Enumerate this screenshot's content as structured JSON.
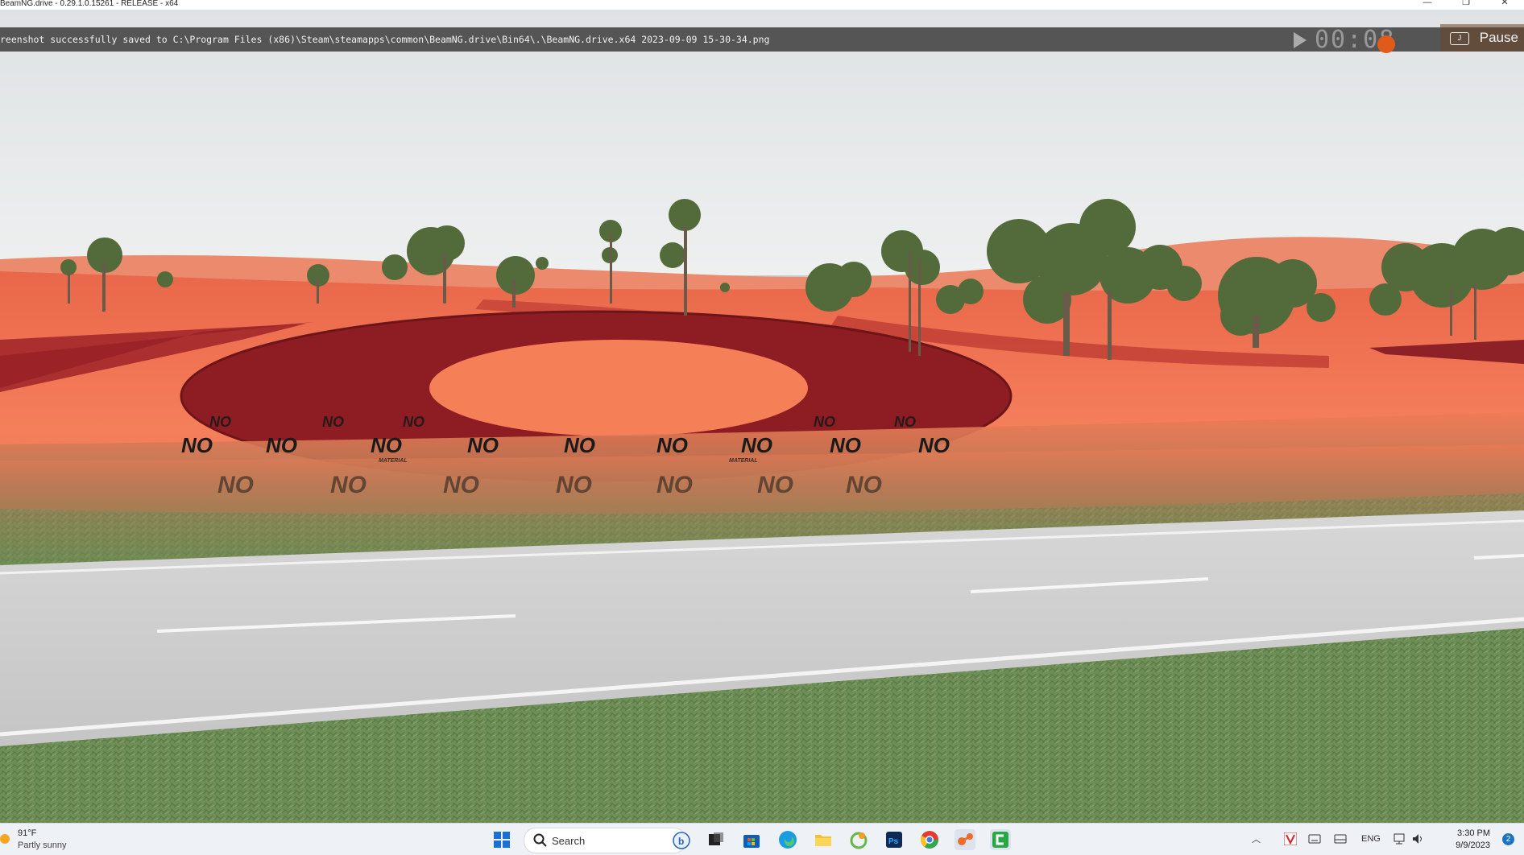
{
  "window": {
    "title": "BeamNG.drive - 0.29.1.0.15261 - RELEASE - x64",
    "minimize_glyph": "—",
    "restore_glyph": "❐",
    "close_glyph": "✕"
  },
  "console": {
    "message": "reenshot successfully saved to C:\\Program Files (x86)\\Steam\\steamapps\\common\\BeamNG.drive\\Bin64\\.\\BeamNG.drive.x64 2023-09-09 15-30-34.png"
  },
  "replay": {
    "timer": "00:08",
    "pause_label": "Pause",
    "pause_key": "J",
    "record_color": "#e05a1a"
  },
  "scene": {
    "ground_labels": [
      "NO",
      "NO",
      "NO",
      "NO",
      "NO",
      "NO",
      "NO",
      "NO",
      "NO"
    ],
    "ground_sublabel": "MATERIAL",
    "sky_color": "#e7e9ea",
    "terrain_color": "#f27a57",
    "grass_color": "#6f8f55",
    "road_color": "#cfcfcf"
  },
  "taskbar": {
    "weather": {
      "temperature": "91°F",
      "condition": "Partly sunny",
      "icon": "sun-icon"
    },
    "search_placeholder": "Search",
    "pinned_apps": [
      {
        "name": "start-button",
        "icon": "windows-logo-icon",
        "color": "#1a6fd8"
      },
      {
        "name": "copilot",
        "icon": "bing-copilot-icon",
        "color": "#2a63b8"
      },
      {
        "name": "task-view",
        "icon": "task-view-icon",
        "color": "#222222"
      },
      {
        "name": "microsoft-store",
        "icon": "store-icon",
        "color": "#0b5fb8"
      },
      {
        "name": "edge",
        "icon": "edge-icon",
        "color": "#1b9de2"
      },
      {
        "name": "file-explorer",
        "icon": "folder-icon",
        "color": "#f2c231"
      },
      {
        "name": "greenshot",
        "icon": "greenshot-icon",
        "color": "#63b947"
      },
      {
        "name": "photoshop",
        "icon": "photoshop-icon",
        "color": "#0d2a57"
      },
      {
        "name": "chrome",
        "icon": "chrome-icon",
        "color": "#e23d2e"
      },
      {
        "name": "beamng",
        "icon": "beamng-icon",
        "color": "#ef6c2a"
      },
      {
        "name": "camtasia",
        "icon": "camtasia-icon",
        "color": "#28a745"
      }
    ],
    "tray": {
      "language": "ENG",
      "time": "3:30 PM",
      "date": "9/9/2023",
      "notification_count": "2"
    }
  }
}
